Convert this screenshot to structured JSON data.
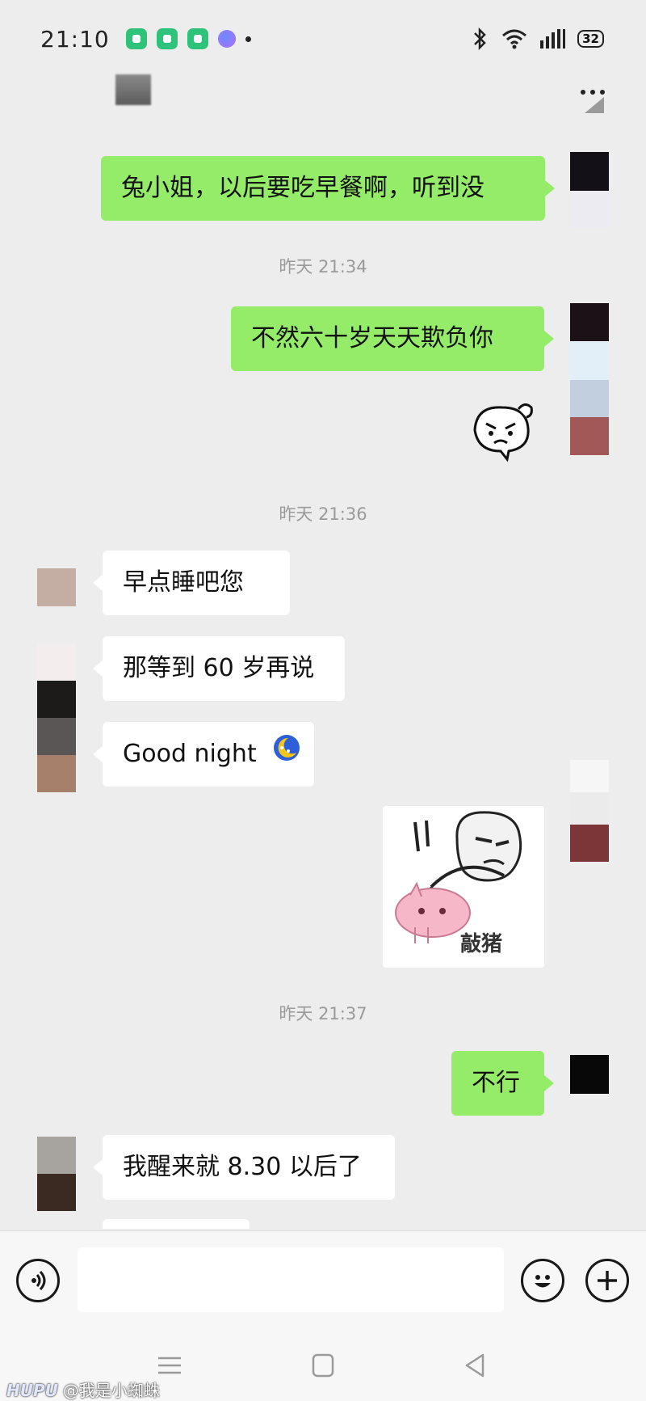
{
  "status_bar": {
    "time": "21:10",
    "battery": "32",
    "icons": [
      "app-notification-icon",
      "app-notification-icon",
      "app-notification-icon",
      "assistant-icon",
      "bluetooth-icon",
      "wifi-icon",
      "signal-icon",
      "battery-icon"
    ]
  },
  "header": {
    "more_icon": "more-icon"
  },
  "messages": [
    {
      "id": "m1",
      "side": "out",
      "type": "text",
      "text": "兔小姐，以后要吃早餐啊，听到没"
    },
    {
      "id": "t1",
      "type": "time",
      "text": "昨天 21:34"
    },
    {
      "id": "m2",
      "side": "out",
      "type": "text",
      "text": "不然六十岁天天欺负你"
    },
    {
      "id": "m3",
      "side": "out",
      "type": "sticker",
      "sticker": "grumpy-face-sticker"
    },
    {
      "id": "t2",
      "type": "time",
      "text": "昨天 21:36"
    },
    {
      "id": "m4",
      "side": "in",
      "type": "text",
      "text": "早点睡吧您"
    },
    {
      "id": "m5",
      "side": "in",
      "type": "text",
      "text": "那等到 60 岁再说"
    },
    {
      "id": "m6",
      "side": "in",
      "type": "text",
      "text": "Good night",
      "emoji": "moon-emoji"
    },
    {
      "id": "m7",
      "side": "out",
      "type": "sticker",
      "sticker": "knock-pig-sticker",
      "caption": "敲猪"
    },
    {
      "id": "t3",
      "type": "time",
      "text": "昨天 21:37"
    },
    {
      "id": "m8",
      "side": "out",
      "type": "text",
      "text": "不行"
    },
    {
      "id": "m9",
      "side": "in",
      "type": "text",
      "text": "我醒来就 8.30 以后了"
    }
  ],
  "input_bar": {
    "value": "",
    "placeholder": ""
  },
  "watermark": {
    "brand": "HUPU",
    "handle": "@我是小蜘蛛"
  },
  "colors": {
    "outgoing_bubble": "#95ec69",
    "incoming_bubble": "#ffffff",
    "background": "#ededed"
  }
}
